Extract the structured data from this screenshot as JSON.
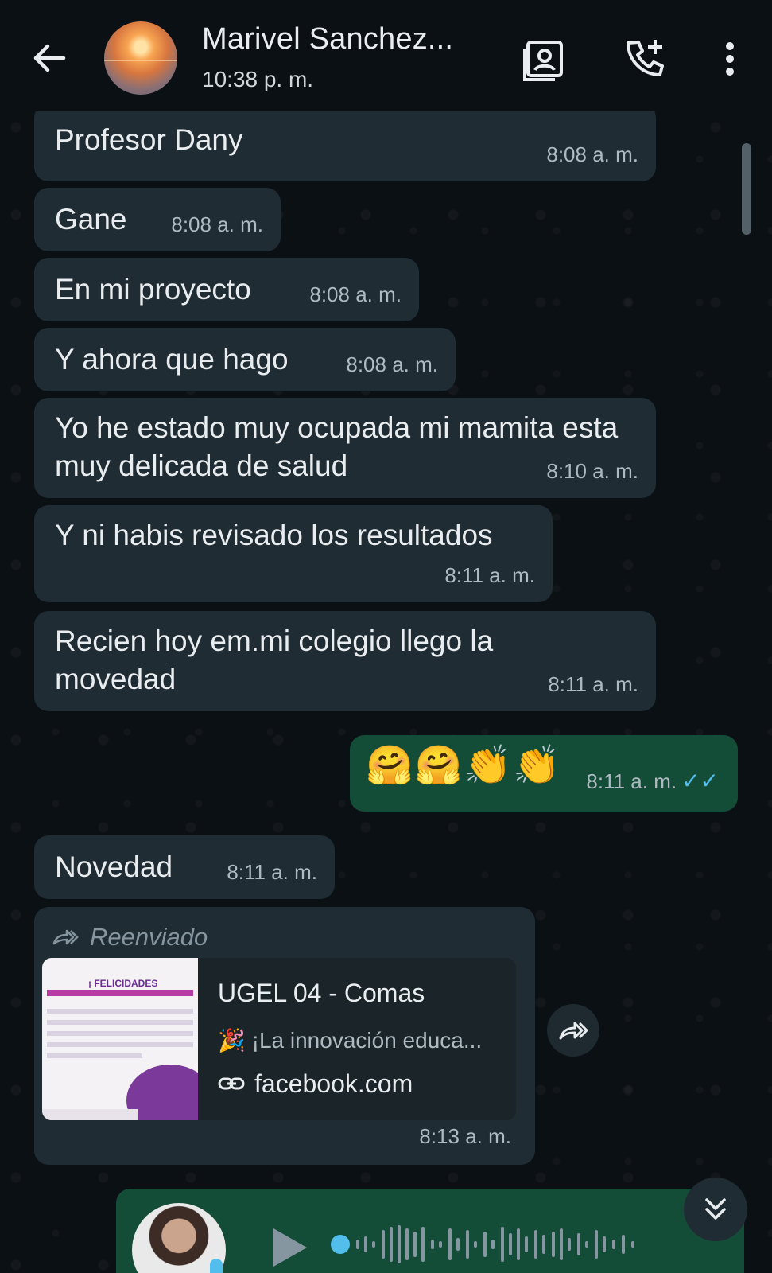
{
  "header": {
    "contact_name": "Marivel Sanchez...",
    "last_seen": "10:38 p. m."
  },
  "messages": [
    {
      "text": "Profesor Dany",
      "time": "8:08 a. m."
    },
    {
      "text": "Gane",
      "time": "8:08 a. m."
    },
    {
      "text": "En mi proyecto",
      "time": "8:08 a. m."
    },
    {
      "text": "Y ahora que hago",
      "time": "8:08 a. m."
    },
    {
      "text": "Yo he estado muy ocupada mi mamita esta muy delicada de salud",
      "time": "8:10 a. m."
    },
    {
      "text": "Y ni habis revisado los resultados",
      "time": "8:11 a. m."
    },
    {
      "text": "Recien hoy em.mi colegio llego la movedad",
      "time": "8:11 a. m."
    },
    {
      "text": "🤗🤗👏👏",
      "time": "8:11 a. m."
    },
    {
      "text": "Novedad",
      "time": "8:11 a. m."
    }
  ],
  "forwarded": {
    "label": "Reenviado",
    "card_title": "UGEL 04 - Comas",
    "card_description": "🎉 ¡La innovación educa...",
    "card_domain": "facebook.com",
    "thumb_heading": "¡ FELICIDADES",
    "time": "8:13 a. m."
  },
  "colors": {
    "background": "#0b1014",
    "incoming_bubble": "#202c33",
    "outgoing_bubble": "#144d37",
    "read_ticks": "#53bdeb"
  }
}
